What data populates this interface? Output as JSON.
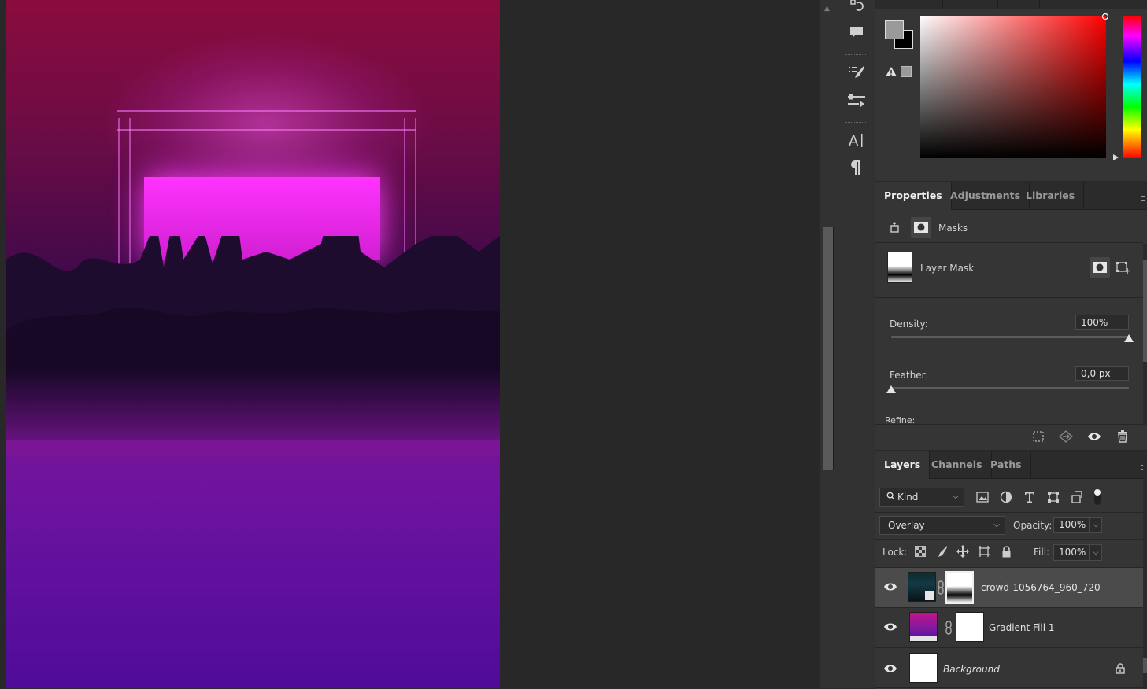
{
  "properties": {
    "tabs": [
      {
        "label": "Properties",
        "active": true
      },
      {
        "label": "Adjustments",
        "active": false
      },
      {
        "label": "Libraries",
        "active": false
      }
    ],
    "section_label": "Masks",
    "mask_name": "Layer Mask",
    "density_label": "Density:",
    "density_value": "100%",
    "density_level_percent": 100,
    "feather_label": "Feather:",
    "feather_value": "0,0 px",
    "feather_level_percent": 0,
    "refine_label": "Refine:"
  },
  "layers_panel": {
    "tabs": [
      {
        "label": "Layers",
        "active": true
      },
      {
        "label": "Channels",
        "active": false
      },
      {
        "label": "Paths",
        "active": false
      }
    ],
    "filter_kind": "Kind",
    "blend_mode": "Overlay",
    "opacity_label": "Opacity:",
    "opacity_value": "100%",
    "lock_label": "Lock:",
    "fill_label": "Fill:",
    "fill_value": "100%",
    "layers": [
      {
        "name": "crowd-1056764_960_720",
        "selected": true,
        "visible": true
      },
      {
        "name": "Gradient Fill 1",
        "selected": false,
        "visible": true
      },
      {
        "name": "Background",
        "selected": false,
        "visible": true,
        "locked": true
      }
    ]
  },
  "colors": {
    "foreground": "#9a9a9a",
    "background": "#000000",
    "picker_hue": "#ff0000"
  },
  "icons": {
    "tools": [
      "history-icon",
      "comment-icon",
      "brush-settings-icon",
      "adjustments-sliders-icon",
      "character-icon",
      "paragraph-icon"
    ],
    "mask_actions": [
      "load-selection-icon",
      "apply-mask-icon",
      "toggle-mask-icon",
      "delete-mask-icon"
    ],
    "filters": [
      "image-filter-icon",
      "adjustment-filter-icon",
      "type-filter-icon",
      "shape-filter-icon",
      "smart-object-filter-icon",
      "filter-toggle-icon"
    ]
  }
}
